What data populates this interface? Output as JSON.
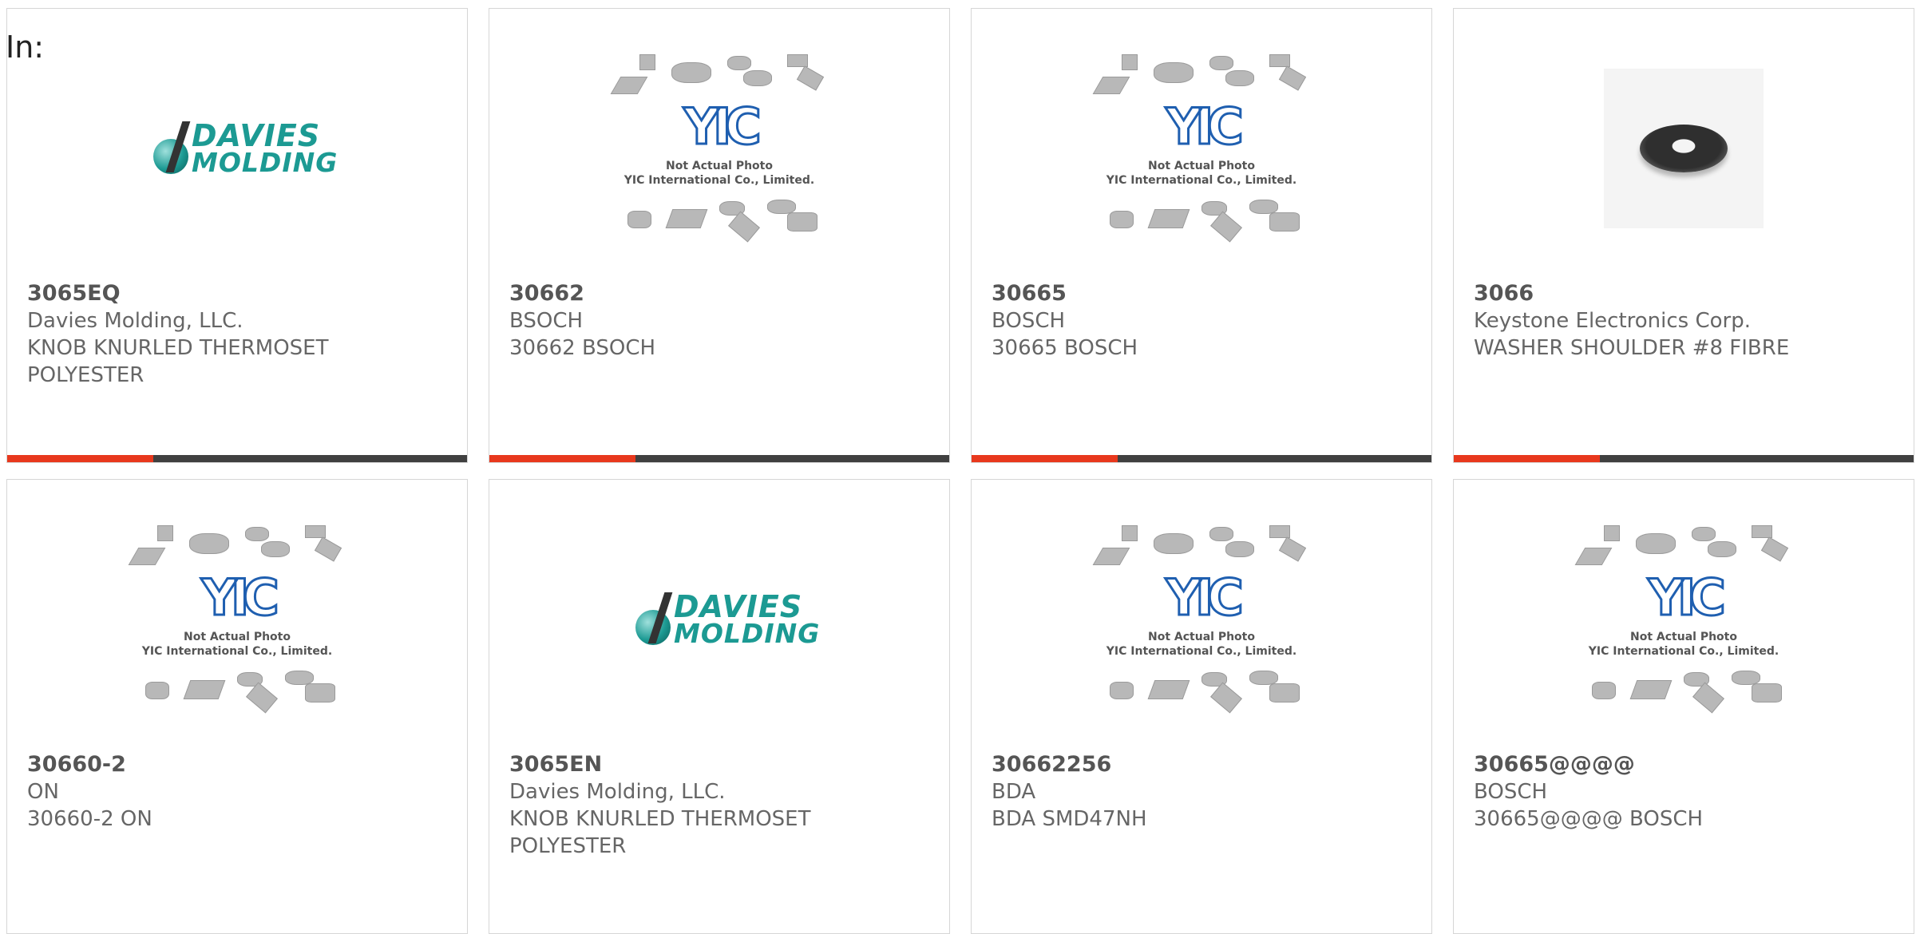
{
  "prefix_label": "In:",
  "products": [
    {
      "part": "3065EQ",
      "mfr": "Davies Molding, LLC.",
      "desc": "KNOB KNURLED THERMOSET",
      "desc2": "POLYESTER",
      "image": "davies-logo"
    },
    {
      "part": "30662",
      "mfr": "BSOCH",
      "desc": "30662 BSOCH",
      "desc2": "",
      "image": "yic-placeholder"
    },
    {
      "part": "30665",
      "mfr": "BOSCH",
      "desc": "30665 BOSCH",
      "desc2": "",
      "image": "yic-placeholder"
    },
    {
      "part": "3066",
      "mfr": "Keystone Electronics Corp.",
      "desc": "WASHER SHOULDER #8 FIBRE",
      "desc2": "",
      "image": "washer-photo"
    },
    {
      "part": "30660-2",
      "mfr": "ON",
      "desc": "30660-2 ON",
      "desc2": "",
      "image": "yic-placeholder"
    },
    {
      "part": "3065EN",
      "mfr": "Davies Molding, LLC.",
      "desc": "KNOB KNURLED THERMOSET",
      "desc2": "POLYESTER",
      "image": "davies-logo"
    },
    {
      "part": "30662256",
      "mfr": "BDA",
      "desc": "BDA SMD47NH",
      "desc2": "",
      "image": "yic-placeholder"
    },
    {
      "part": "30665@@@@",
      "mfr": "BOSCH",
      "desc": "30665@@@@ BOSCH",
      "desc2": "",
      "image": "yic-placeholder"
    }
  ],
  "images": {
    "davies": {
      "line1": "DAVIES",
      "line2": "MOLDING"
    },
    "yic": {
      "mark": "YIC",
      "caption1": "Not Actual Photo",
      "caption2": "YIC International Co., Limited."
    }
  },
  "colors": {
    "accent": "#e8381d",
    "bar": "#404040",
    "teal": "#1c9a93",
    "yic_blue": "#1f5fb0"
  }
}
